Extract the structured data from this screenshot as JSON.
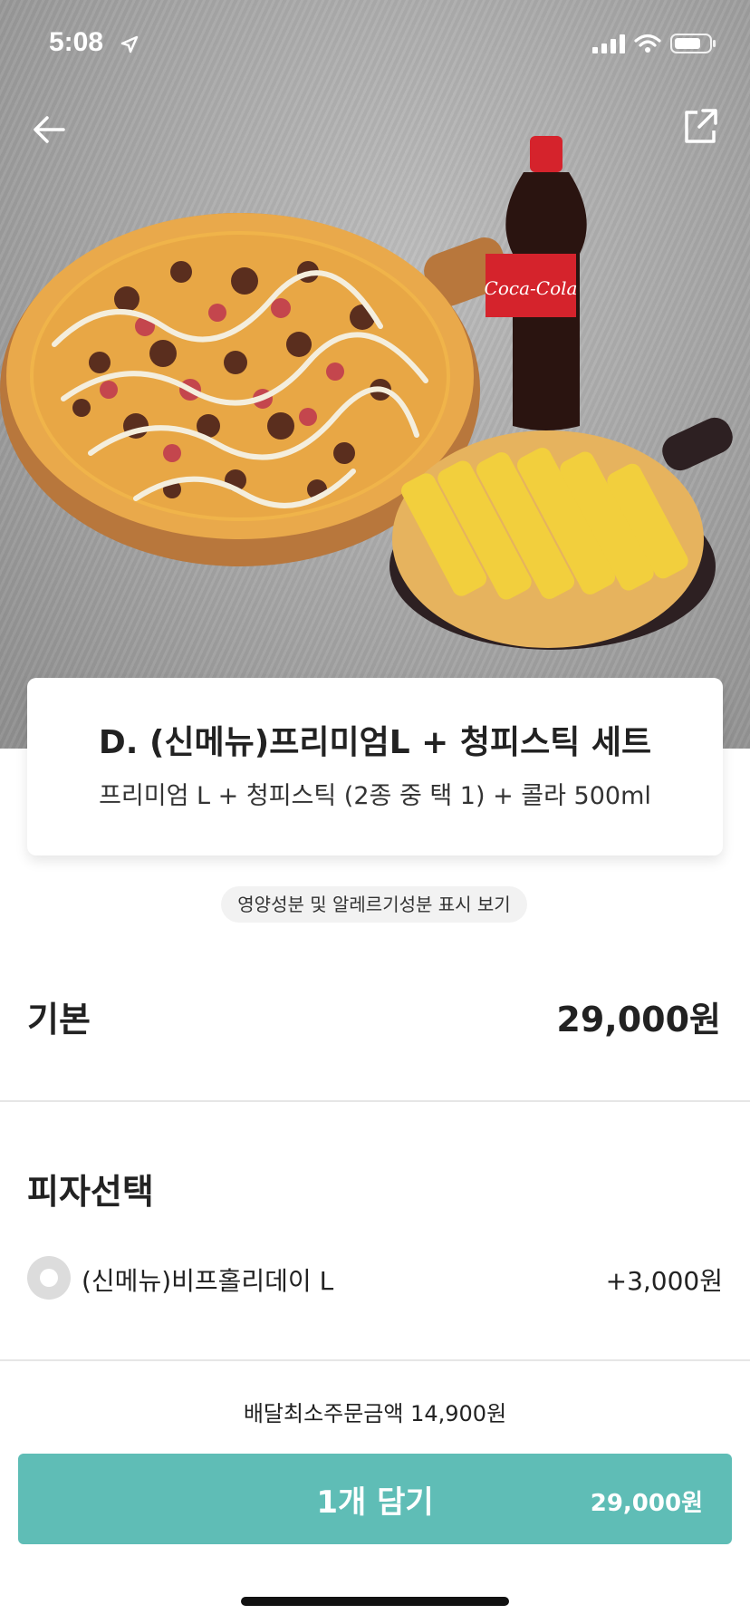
{
  "status_bar": {
    "time": "5:08"
  },
  "product": {
    "title": "D. (신메뉴)프리미엄L + 청피스틱 세트",
    "description": "프리미엄 L + 청피스틱 (2종 중 택 1) + 콜라 500ml",
    "nutrition_link": "영양성분 및 알레르기성분 표시 보기",
    "bottle_label": "Coca-Cola"
  },
  "basic": {
    "label": "기본",
    "price": "29,000원"
  },
  "pizza_selection": {
    "heading": "피자선택",
    "options": [
      {
        "label": "(신메뉴)비프홀리데이 L",
        "price": "+3,000원"
      }
    ]
  },
  "footer": {
    "min_order": "배달최소주문금액 14,900원",
    "cart_label": "1개 담기",
    "cart_price": "29,000원"
  },
  "colors": {
    "accent": "#5fbdb6"
  }
}
